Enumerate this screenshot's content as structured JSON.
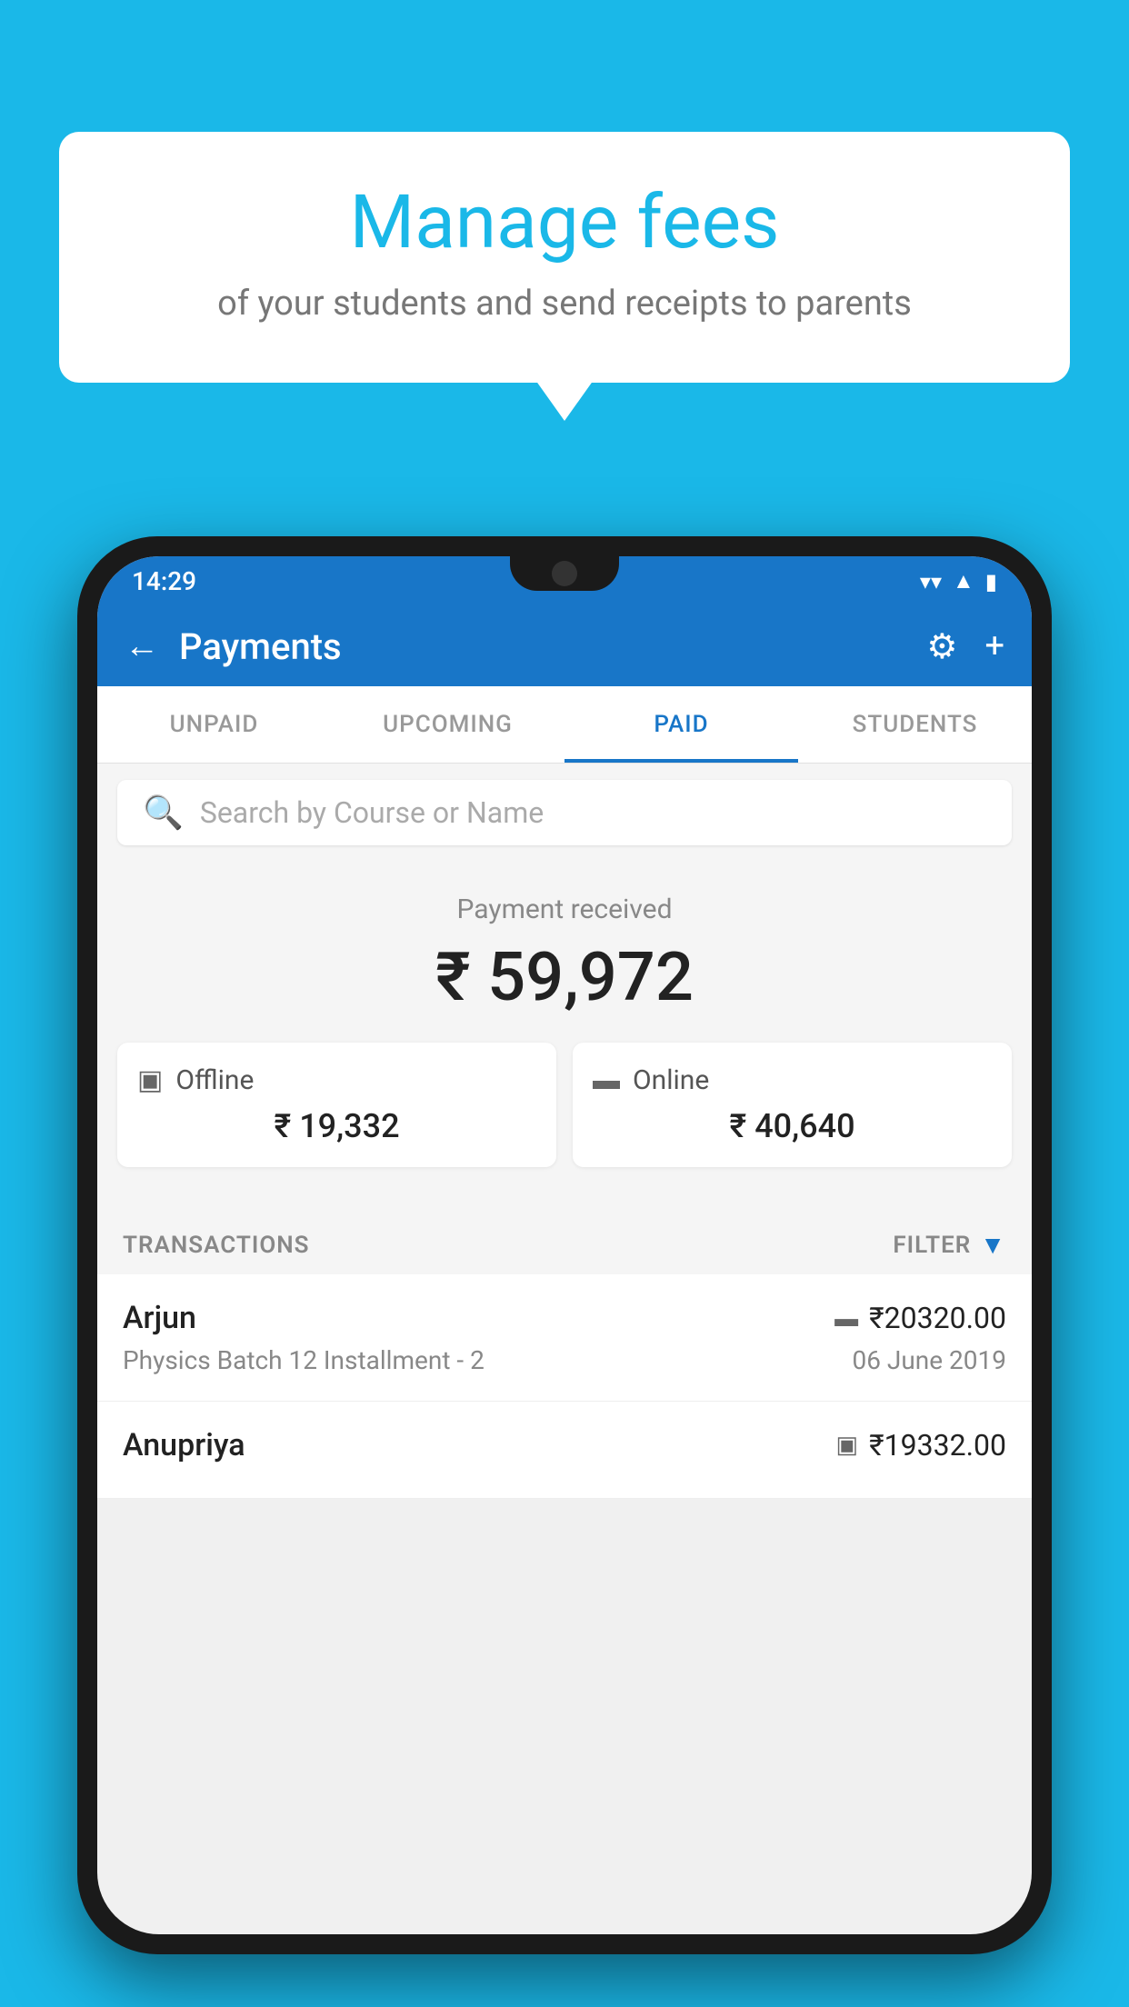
{
  "background_color": "#1ab8e8",
  "speech_bubble": {
    "title": "Manage fees",
    "subtitle": "of your students and send receipts to parents"
  },
  "status_bar": {
    "time": "14:29",
    "icons": [
      "wifi",
      "signal",
      "battery"
    ]
  },
  "header": {
    "title": "Payments",
    "back_label": "←",
    "gear_label": "⚙",
    "plus_label": "+"
  },
  "tabs": [
    {
      "label": "UNPAID",
      "active": false
    },
    {
      "label": "UPCOMING",
      "active": false
    },
    {
      "label": "PAID",
      "active": true
    },
    {
      "label": "STUDENTS",
      "active": false
    }
  ],
  "search": {
    "placeholder": "Search by Course or Name"
  },
  "payment_summary": {
    "label": "Payment received",
    "amount": "₹ 59,972",
    "offline": {
      "label": "Offline",
      "amount": "₹ 19,332"
    },
    "online": {
      "label": "Online",
      "amount": "₹ 40,640"
    }
  },
  "transactions_section": {
    "label": "TRANSACTIONS",
    "filter_label": "FILTER"
  },
  "transactions": [
    {
      "name": "Arjun",
      "amount": "₹20320.00",
      "course": "Physics Batch 12 Installment - 2",
      "date": "06 June 2019",
      "payment_type": "online"
    },
    {
      "name": "Anupriya",
      "amount": "₹19332.00",
      "course": "",
      "date": "",
      "payment_type": "offline"
    }
  ]
}
